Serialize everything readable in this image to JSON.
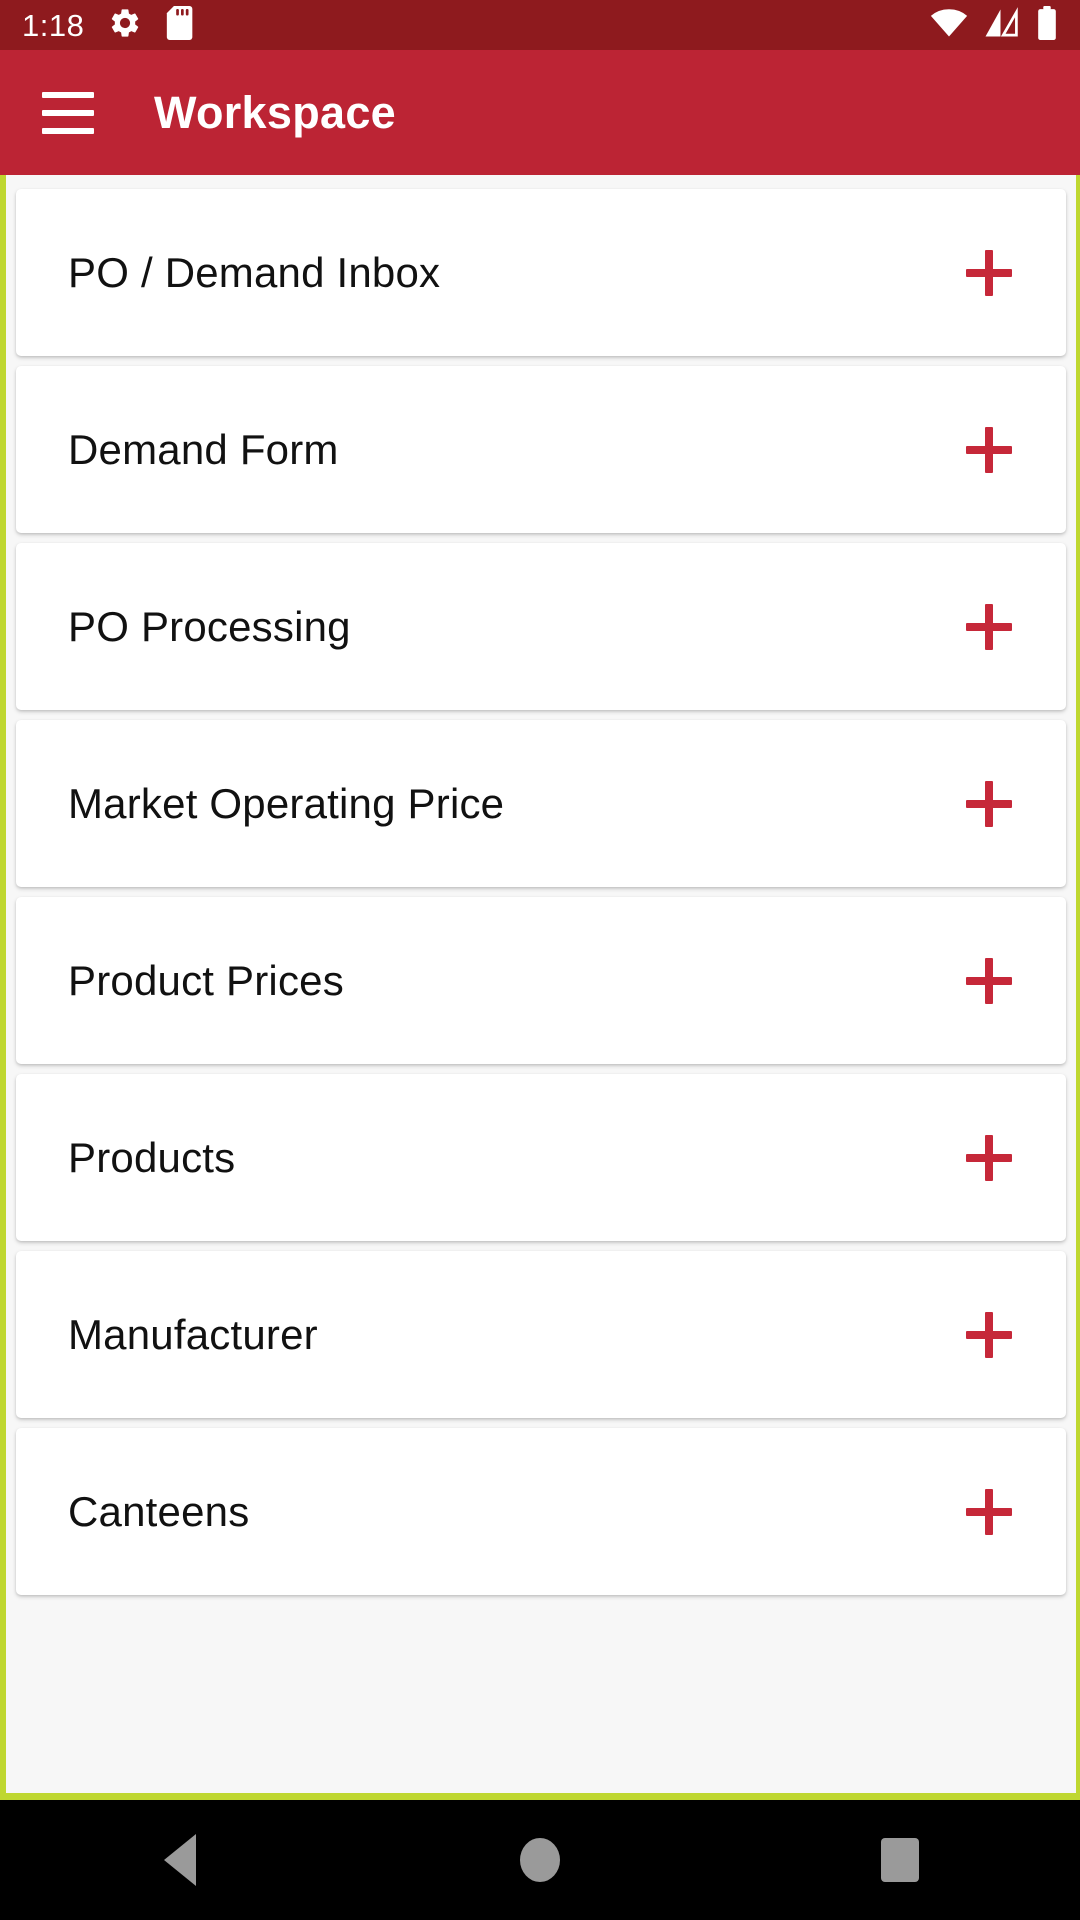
{
  "status_bar": {
    "time": "1:18",
    "icons": [
      "gear-icon",
      "sd-card-icon"
    ],
    "right_icons": [
      "wifi-icon",
      "cellular-signal-icon",
      "battery-icon"
    ],
    "background_color": "#8E1A1E"
  },
  "app_bar": {
    "menu_icon": "hamburger-menu-icon",
    "title": "Workspace",
    "background_color": "#BC2434"
  },
  "recording_border_color": "#BFD730",
  "accent_color": "#C62839",
  "list": {
    "items": [
      {
        "label": "PO / Demand Inbox",
        "action_icon": "plus-icon"
      },
      {
        "label": "Demand Form",
        "action_icon": "plus-icon"
      },
      {
        "label": "PO Processing",
        "action_icon": "plus-icon"
      },
      {
        "label": "Market Operating Price",
        "action_icon": "plus-icon"
      },
      {
        "label": "Product Prices",
        "action_icon": "plus-icon"
      },
      {
        "label": "Products",
        "action_icon": "plus-icon"
      },
      {
        "label": "Manufacturer",
        "action_icon": "plus-icon"
      },
      {
        "label": "Canteens",
        "action_icon": "plus-icon"
      }
    ]
  },
  "nav_bar": {
    "back_label": "Back",
    "home_label": "Home",
    "recents_label": "Recents"
  }
}
